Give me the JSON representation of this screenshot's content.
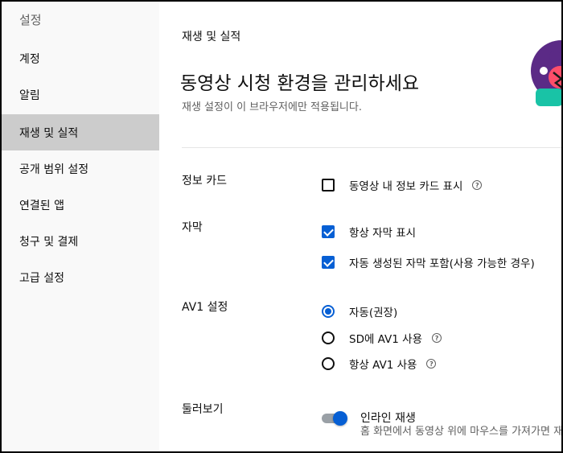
{
  "sidebar": {
    "title": "설정",
    "items": [
      {
        "label": "계정"
      },
      {
        "label": "알림"
      },
      {
        "label": "재생 및 실적"
      },
      {
        "label": "공개 범위 설정"
      },
      {
        "label": "연결된 앱"
      },
      {
        "label": "청구 및 결제"
      },
      {
        "label": "고급 설정"
      }
    ],
    "active_index": 2
  },
  "main": {
    "breadcrumb": "재생 및 실적",
    "heading": "동영상 시청 환경을 관리하세요",
    "subheading": "재생 설정이 이 브라우저에만 적용됩니다.",
    "info_cards": {
      "label": "정보 카드",
      "option": {
        "label": "동영상 내 정보 카드 표시",
        "checked": false
      }
    },
    "captions": {
      "label": "자막",
      "options": [
        {
          "label": "항상 자막 표시",
          "checked": true
        },
        {
          "label": "자동 생성된 자막 포함(사용 가능한 경우)",
          "checked": true
        }
      ]
    },
    "av1": {
      "label": "AV1 설정",
      "options": [
        {
          "label": "자동(권장)",
          "selected": true
        },
        {
          "label": "SD에 AV1 사용",
          "selected": false
        },
        {
          "label": "항상 AV1 사용",
          "selected": false
        }
      ]
    },
    "browse": {
      "label": "둘러보기",
      "toggle": {
        "label": "인라인 재생",
        "on": true,
        "description": "홈 화면에서 동영상 위에 마우스를 가져가면 재생됩니다"
      }
    }
  },
  "icons": {
    "help": "help-circle-icon"
  },
  "colors": {
    "accent": "#065fd4",
    "sidebar_active": "#cccccc",
    "sidebar_bg": "#f9f9f9"
  }
}
